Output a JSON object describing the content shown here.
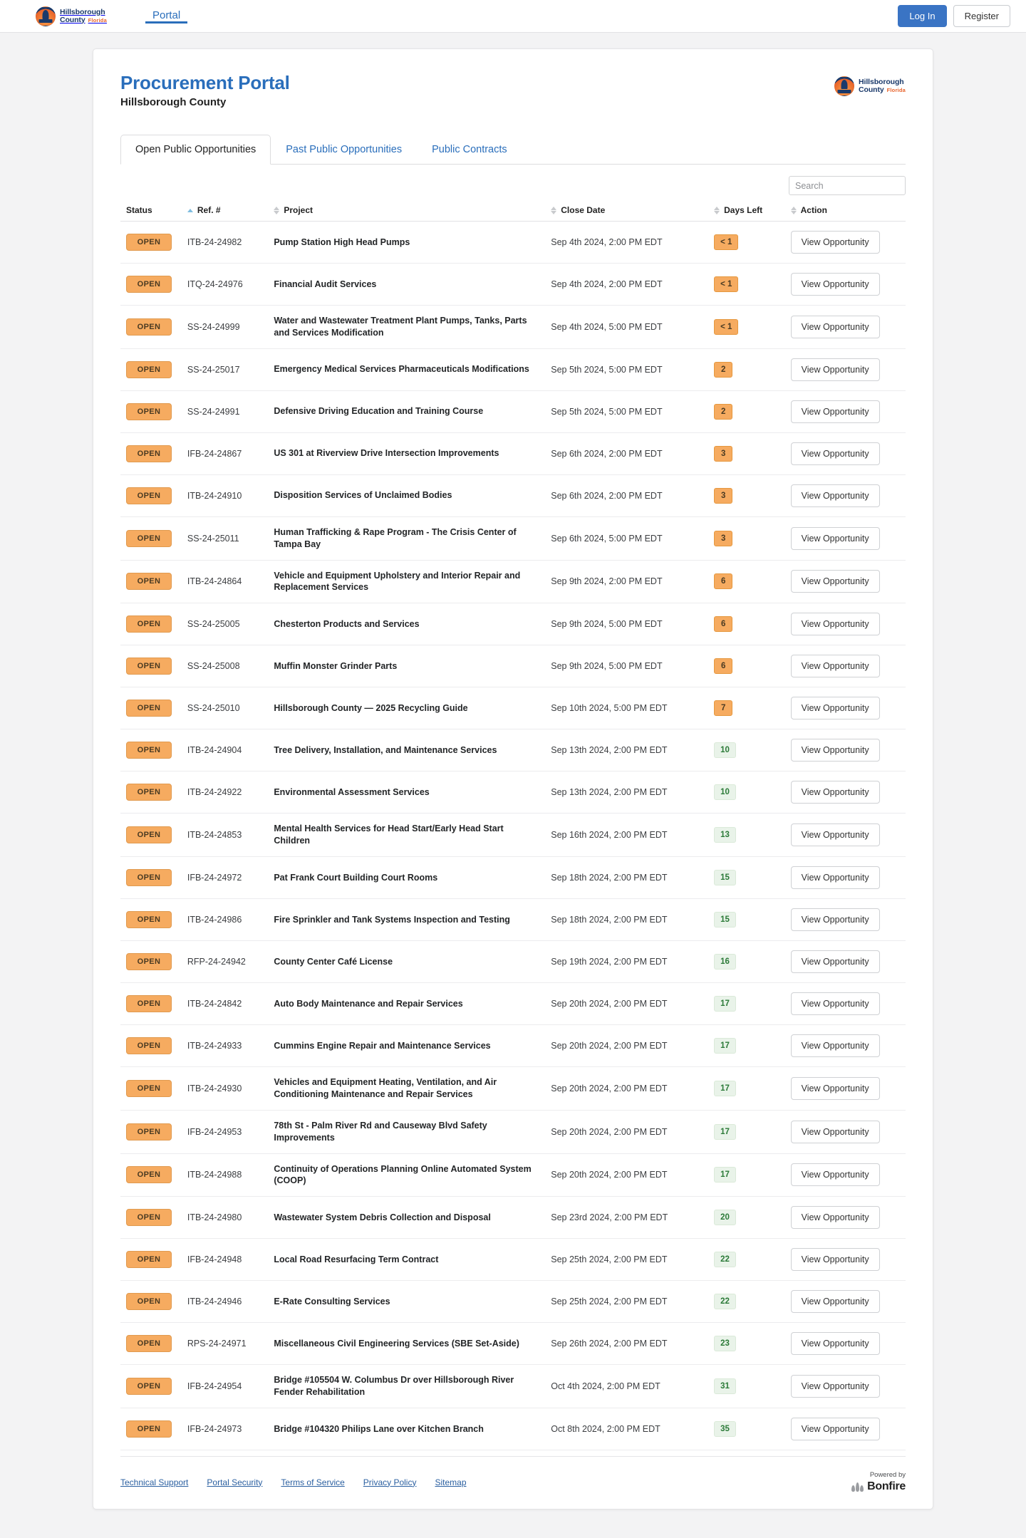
{
  "navbar": {
    "logo": {
      "line1": "Hillsborough",
      "line2": "County",
      "state": "Florida",
      "icon": "hillsborough-county-seal-icon"
    },
    "tabs": [
      {
        "label": "Portal",
        "active": true
      }
    ],
    "login_label": "Log In",
    "register_label": "Register"
  },
  "header": {
    "title": "Procurement Portal",
    "subtitle": "Hillsborough County",
    "logo": {
      "line1": "Hillsborough",
      "line2": "County",
      "state": "Florida",
      "icon": "hillsborough-county-seal-icon"
    }
  },
  "tabs": [
    {
      "label": "Open Public Opportunities",
      "active": true
    },
    {
      "label": "Past Public Opportunities",
      "active": false
    },
    {
      "label": "Public Contracts",
      "active": false
    }
  ],
  "search": {
    "placeholder": "Search",
    "value": ""
  },
  "table": {
    "columns": [
      {
        "label": "Status",
        "sortable": true,
        "sorted": "asc"
      },
      {
        "label": "Ref. #",
        "sortable": true,
        "sorted": "none"
      },
      {
        "label": "Project",
        "sortable": true,
        "sorted": "none"
      },
      {
        "label": "Close Date",
        "sortable": true,
        "sorted": "none"
      },
      {
        "label": "Days Left",
        "sortable": true,
        "sorted": "none"
      },
      {
        "label": "Action",
        "sortable": false,
        "sorted": "none"
      }
    ],
    "action_label": "View Opportunity",
    "rows": [
      {
        "status": "OPEN",
        "ref": "ITB-24-24982",
        "project": "Pump Station High Head Pumps",
        "close": "Sep 4th 2024, 2:00 PM EDT",
        "days": "< 1",
        "urgent": true
      },
      {
        "status": "OPEN",
        "ref": "ITQ-24-24976",
        "project": "Financial Audit Services",
        "close": "Sep 4th 2024, 2:00 PM EDT",
        "days": "< 1",
        "urgent": true
      },
      {
        "status": "OPEN",
        "ref": "SS-24-24999",
        "project": "Water and Wastewater Treatment Plant Pumps, Tanks, Parts and Services Modification",
        "close": "Sep 4th 2024, 5:00 PM EDT",
        "days": "< 1",
        "urgent": true
      },
      {
        "status": "OPEN",
        "ref": "SS-24-25017",
        "project": "Emergency Medical Services Pharmaceuticals Modifications",
        "close": "Sep 5th 2024, 5:00 PM EDT",
        "days": "2",
        "urgent": true
      },
      {
        "status": "OPEN",
        "ref": "SS-24-24991",
        "project": "Defensive Driving Education and Training Course",
        "close": "Sep 5th 2024, 5:00 PM EDT",
        "days": "2",
        "urgent": true
      },
      {
        "status": "OPEN",
        "ref": "IFB-24-24867",
        "project": "US 301 at Riverview Drive Intersection Improvements",
        "close": "Sep 6th 2024, 2:00 PM EDT",
        "days": "3",
        "urgent": true
      },
      {
        "status": "OPEN",
        "ref": "ITB-24-24910",
        "project": "Disposition Services of Unclaimed Bodies",
        "close": "Sep 6th 2024, 2:00 PM EDT",
        "days": "3",
        "urgent": true
      },
      {
        "status": "OPEN",
        "ref": "SS-24-25011",
        "project": "Human Trafficking & Rape Program - The Crisis Center of Tampa Bay",
        "close": "Sep 6th 2024, 5:00 PM EDT",
        "days": "3",
        "urgent": true
      },
      {
        "status": "OPEN",
        "ref": "ITB-24-24864",
        "project": "Vehicle and Equipment Upholstery and Interior Repair and Replacement Services",
        "close": "Sep 9th 2024, 2:00 PM EDT",
        "days": "6",
        "urgent": true
      },
      {
        "status": "OPEN",
        "ref": "SS-24-25005",
        "project": "Chesterton Products and Services",
        "close": "Sep 9th 2024, 5:00 PM EDT",
        "days": "6",
        "urgent": true
      },
      {
        "status": "OPEN",
        "ref": "SS-24-25008",
        "project": "Muffin Monster Grinder Parts",
        "close": "Sep 9th 2024, 5:00 PM EDT",
        "days": "6",
        "urgent": true
      },
      {
        "status": "OPEN",
        "ref": "SS-24-25010",
        "project": "Hillsborough County — 2025 Recycling Guide",
        "close": "Sep 10th 2024, 5:00 PM EDT",
        "days": "7",
        "urgent": true
      },
      {
        "status": "OPEN",
        "ref": "ITB-24-24904",
        "project": "Tree Delivery, Installation, and Maintenance Services",
        "close": "Sep 13th 2024, 2:00 PM EDT",
        "days": "10",
        "urgent": false
      },
      {
        "status": "OPEN",
        "ref": "ITB-24-24922",
        "project": "Environmental Assessment Services",
        "close": "Sep 13th 2024, 2:00 PM EDT",
        "days": "10",
        "urgent": false
      },
      {
        "status": "OPEN",
        "ref": "ITB-24-24853",
        "project": "Mental Health Services for Head Start/Early Head Start Children",
        "close": "Sep 16th 2024, 2:00 PM EDT",
        "days": "13",
        "urgent": false
      },
      {
        "status": "OPEN",
        "ref": "IFB-24-24972",
        "project": "Pat Frank Court Building Court Rooms",
        "close": "Sep 18th 2024, 2:00 PM EDT",
        "days": "15",
        "urgent": false
      },
      {
        "status": "OPEN",
        "ref": "ITB-24-24986",
        "project": "Fire Sprinkler and Tank Systems Inspection and Testing",
        "close": "Sep 18th 2024, 2:00 PM EDT",
        "days": "15",
        "urgent": false
      },
      {
        "status": "OPEN",
        "ref": "RFP-24-24942",
        "project": "County Center Café License",
        "close": "Sep 19th 2024, 2:00 PM EDT",
        "days": "16",
        "urgent": false
      },
      {
        "status": "OPEN",
        "ref": "ITB-24-24842",
        "project": "Auto Body Maintenance and Repair Services",
        "close": "Sep 20th 2024, 2:00 PM EDT",
        "days": "17",
        "urgent": false
      },
      {
        "status": "OPEN",
        "ref": "ITB-24-24933",
        "project": "Cummins Engine Repair and Maintenance Services",
        "close": "Sep 20th 2024, 2:00 PM EDT",
        "days": "17",
        "urgent": false
      },
      {
        "status": "OPEN",
        "ref": "ITB-24-24930",
        "project": "Vehicles and Equipment Heating, Ventilation, and Air Conditioning Maintenance and Repair Services",
        "close": "Sep 20th 2024, 2:00 PM EDT",
        "days": "17",
        "urgent": false
      },
      {
        "status": "OPEN",
        "ref": "IFB-24-24953",
        "project": "78th St - Palm River Rd and Causeway Blvd Safety Improvements",
        "close": "Sep 20th 2024, 2:00 PM EDT",
        "days": "17",
        "urgent": false
      },
      {
        "status": "OPEN",
        "ref": "ITB-24-24988",
        "project": "Continuity of Operations Planning Online Automated System (COOP)",
        "close": "Sep 20th 2024, 2:00 PM EDT",
        "days": "17",
        "urgent": false
      },
      {
        "status": "OPEN",
        "ref": "ITB-24-24980",
        "project": "Wastewater System Debris Collection and Disposal",
        "close": "Sep 23rd 2024, 2:00 PM EDT",
        "days": "20",
        "urgent": false
      },
      {
        "status": "OPEN",
        "ref": "IFB-24-24948",
        "project": "Local Road Resurfacing Term Contract",
        "close": "Sep 25th 2024, 2:00 PM EDT",
        "days": "22",
        "urgent": false
      },
      {
        "status": "OPEN",
        "ref": "ITB-24-24946",
        "project": "E-Rate Consulting Services",
        "close": "Sep 25th 2024, 2:00 PM EDT",
        "days": "22",
        "urgent": false
      },
      {
        "status": "OPEN",
        "ref": "RPS-24-24971",
        "project": "Miscellaneous Civil Engineering Services (SBE Set-Aside)",
        "close": "Sep 26th 2024, 2:00 PM EDT",
        "days": "23",
        "urgent": false
      },
      {
        "status": "OPEN",
        "ref": "IFB-24-24954",
        "project": "Bridge #105504 W. Columbus Dr over Hillsborough River Fender Rehabilitation",
        "close": "Oct 4th 2024, 2:00 PM EDT",
        "days": "31",
        "urgent": false
      },
      {
        "status": "OPEN",
        "ref": "IFB-24-24973",
        "project": "Bridge #104320 Philips Lane over Kitchen Branch",
        "close": "Oct 8th 2024, 2:00 PM EDT",
        "days": "35",
        "urgent": false
      }
    ]
  },
  "footer": {
    "links": [
      {
        "label": "Technical Support"
      },
      {
        "label": "Portal Security"
      },
      {
        "label": "Terms of Service"
      },
      {
        "label": "Privacy Policy"
      },
      {
        "label": "Sitemap"
      }
    ],
    "powered_by": "Powered by",
    "brand": "Bonfire"
  },
  "colors": {
    "accent_blue": "#2a6ebb",
    "login_blue": "#3a74c4",
    "badge_orange": "#f6ab60",
    "badge_green_bg": "#e9f3e9",
    "badge_green_text": "#2b7a38",
    "logo_navy": "#1b3a6b",
    "logo_orange": "#e8622a"
  }
}
